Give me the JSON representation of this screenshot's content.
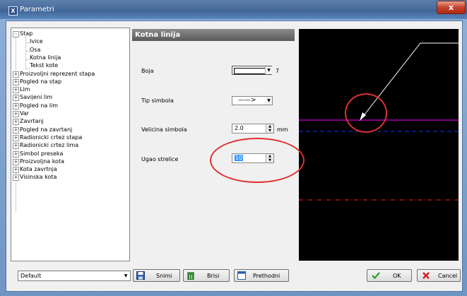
{
  "window": {
    "title": "Parametri",
    "close": "x"
  },
  "tree": {
    "items": [
      {
        "label": "Stap",
        "level": 0,
        "expander": "-"
      },
      {
        "label": "Ivice",
        "level": 1
      },
      {
        "label": "Osa",
        "level": 1
      },
      {
        "label": "Kotna linija",
        "level": 1,
        "selected": true
      },
      {
        "label": "Tekst kote",
        "level": 1
      },
      {
        "label": "Proizvoljni reprezent stapa",
        "level": 0,
        "expander": "+"
      },
      {
        "label": "Pogled na stap",
        "level": 0,
        "expander": "+"
      },
      {
        "label": "Lim",
        "level": 0,
        "expander": "+"
      },
      {
        "label": "Savijeni lim",
        "level": 0,
        "expander": "+"
      },
      {
        "label": "Pogled na lim",
        "level": 0,
        "expander": "+"
      },
      {
        "label": "Var",
        "level": 0,
        "expander": "+"
      },
      {
        "label": "Zavrtanj",
        "level": 0,
        "expander": "+"
      },
      {
        "label": "Pogled na zavrtanj",
        "level": 0,
        "expander": "+"
      },
      {
        "label": "Radionicki crtez stapa",
        "level": 0,
        "expander": "+"
      },
      {
        "label": "Radionicki crtez lima",
        "level": 0,
        "expander": "+"
      },
      {
        "label": "Simbol preseka",
        "level": 0,
        "expander": "+"
      },
      {
        "label": "Proizvoljna kota",
        "level": 0,
        "expander": "+"
      },
      {
        "label": "Kota zavrtnja",
        "level": 0,
        "expander": "+"
      },
      {
        "label": "Visinska kota",
        "level": 0,
        "expander": "+"
      }
    ]
  },
  "panel": {
    "title": "Kotna linija",
    "boja_label": "Boja",
    "boja_value": "7",
    "tip_label": "Tip simbola",
    "tip_symbol": "——>",
    "velicina_label": "Velicina simbola",
    "velicina_value": "2.0",
    "velicina_unit": "mm",
    "ugao_label": "Ugao strelice",
    "ugao_value": "10"
  },
  "bottom": {
    "preset": "Default",
    "save_label": "Snimi",
    "delete_label": "Brisi",
    "previous_label": "Prethodni",
    "ok_label": "OK",
    "cancel_label": "Cancel"
  },
  "colors": {
    "preview_bg": "#000000",
    "preview_white": "#ffffff",
    "preview_magenta": "#ff00ff",
    "preview_blue": "#2030ff",
    "preview_red": "#ff2020",
    "annotation": "#e03030"
  }
}
